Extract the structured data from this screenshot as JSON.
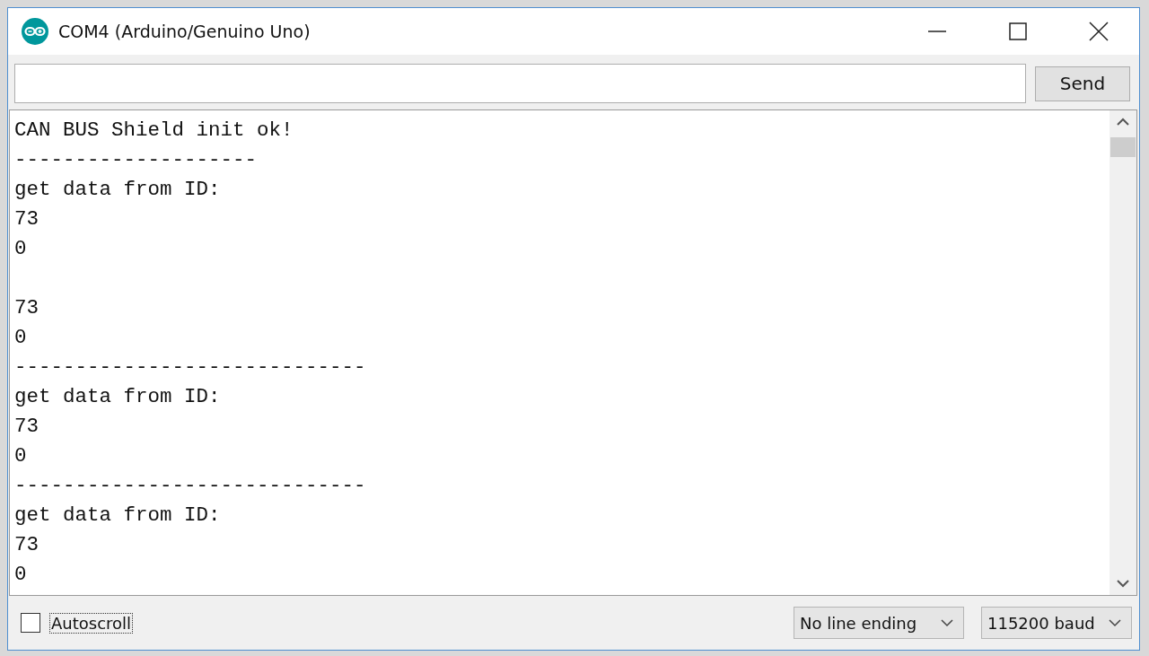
{
  "window": {
    "title": "COM4 (Arduino/Genuino Uno)"
  },
  "send_button": "Send",
  "output": {
    "lines": [
      {
        "kind": "text",
        "text": "CAN BUS Shield init ok!"
      },
      {
        "kind": "text",
        "text": "--------------------"
      },
      {
        "kind": "text",
        "text": "get data from ID:"
      },
      {
        "kind": "text",
        "text": "73"
      },
      {
        "kind": "text",
        "text": "0"
      },
      {
        "kind": "blank"
      },
      {
        "kind": "text",
        "text": "73"
      },
      {
        "kind": "text",
        "text": "0"
      },
      {
        "kind": "text",
        "text": "-----------------------------"
      },
      {
        "kind": "text",
        "text": "get data from ID:"
      },
      {
        "kind": "text",
        "text": "73"
      },
      {
        "kind": "text",
        "text": "0"
      },
      {
        "kind": "text",
        "text": "-----------------------------"
      },
      {
        "kind": "text",
        "text": "get data from ID:"
      },
      {
        "kind": "text",
        "text": "73"
      },
      {
        "kind": "text",
        "text": "0"
      }
    ]
  },
  "autoscroll": {
    "label": "Autoscroll",
    "checked": false
  },
  "line_ending": "No line ending",
  "baud_rate": "115200 baud"
}
